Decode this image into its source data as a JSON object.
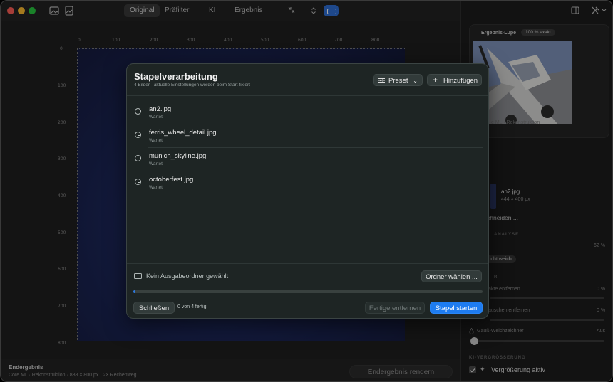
{
  "toolbar": {
    "segments": [
      "Original",
      "Präfilter",
      "KI",
      "Ergebnis"
    ],
    "active_segment": "Original"
  },
  "canvas": {
    "ruler_top": [
      "0",
      "100",
      "200",
      "300",
      "400",
      "500",
      "600",
      "700",
      "800"
    ],
    "ruler_left": [
      "0",
      "100",
      "200",
      "300",
      "400",
      "500",
      "600",
      "700",
      "800"
    ]
  },
  "bottombar": {
    "title": "Endergebnis",
    "info": "Core ML · Rekonstruktion  ·  888 × 800 px  ·  2× Rechenweg",
    "render_label": "Endergebnis rendern"
  },
  "sidebar": {
    "loupe_title": "Ergebnis-Lupe",
    "loupe_badge": "100 % exakt",
    "loupe_footer": "e ML · Rekonstruktion",
    "file_name": "an2.jpg",
    "file_size": "444 × 400 px",
    "crop_label": "chneiden ...",
    "analysis_head": "ANALYSE",
    "analysis_value": "62 %",
    "chip_label": "icht weich",
    "filter_head": "R",
    "artifacts_label": "akte entfernen",
    "artifacts_value": "0 %",
    "noise_label": "auschen entfernen",
    "noise_value": "0 %",
    "gauss_label": "Gauß-Weichzeichner",
    "gauss_value": "Aus",
    "upscale_head": "KI-VERGRÖSSERUNG",
    "upscale_label": "Vergrößerung aktiv"
  },
  "modal": {
    "title": "Stapelverarbeitung",
    "subtitle": "4 Bilder · aktuelle Einstellungen werden beim Start fixiert",
    "preset_label": "Preset",
    "add_label": "Hinzufügen",
    "jobs": [
      {
        "name": "an2.jpg",
        "status": "Wartet"
      },
      {
        "name": "ferris_wheel_detail.jpg",
        "status": "Wartet"
      },
      {
        "name": "munich_skyline.jpg",
        "status": "Wartet"
      },
      {
        "name": "octoberfest.jpg",
        "status": "Wartet"
      }
    ],
    "folder_text": "Kein Ausgabeordner gewählt",
    "choose_folder_label": "Ordner wählen ...",
    "progress_fraction": 0.005,
    "close_label": "Schließen",
    "count_text": "0 von 4 fertig",
    "remove_done_label": "Fertige entfernen",
    "start_label": "Stapel starten"
  }
}
